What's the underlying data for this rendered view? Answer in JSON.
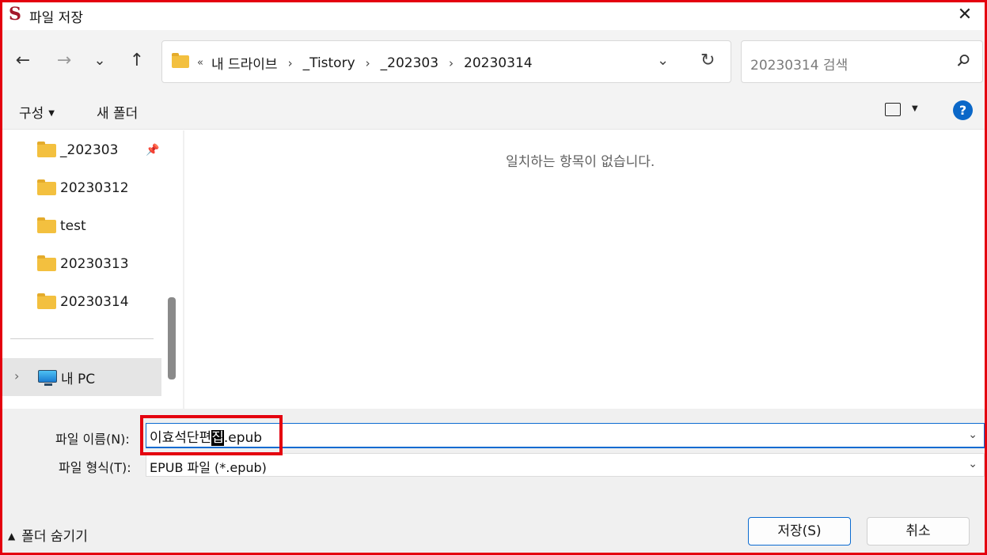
{
  "window": {
    "title": "파일 저장",
    "close_label": "✕"
  },
  "nav": {
    "back": "←",
    "forward": "→",
    "recent": "⌄",
    "up": "↑"
  },
  "address": {
    "overflow": "«",
    "crumbs": [
      "내 드라이브",
      "_Tistory",
      "_202303",
      "20230314"
    ],
    "separator": "›"
  },
  "search": {
    "placeholder": "20230314 검색"
  },
  "toolbar": {
    "organize": "구성",
    "new_folder": "새 폴더",
    "help": "?"
  },
  "tree": {
    "items": [
      {
        "label": "_202303",
        "pinned": true
      },
      {
        "label": "20230312"
      },
      {
        "label": "test"
      },
      {
        "label": "20230313"
      },
      {
        "label": "20230314"
      }
    ],
    "pc": {
      "label": "내 PC"
    }
  },
  "content": {
    "empty_message": "일치하는 항목이 없습니다."
  },
  "form": {
    "file_name_label": "파일 이름(N):",
    "file_name_before": "이효석단편",
    "file_name_selected": "집",
    "file_name_after": ".epub",
    "file_type_label": "파일 형식(T):",
    "file_type_value": "EPUB 파일 (*.epub)"
  },
  "footer": {
    "hide_folders": "폴더 숨기기",
    "save": "저장(S)",
    "cancel": "취소"
  },
  "colors": {
    "accent": "#0b6bd1",
    "highlight_red": "#e4000f",
    "folder": "#f3c03f"
  }
}
